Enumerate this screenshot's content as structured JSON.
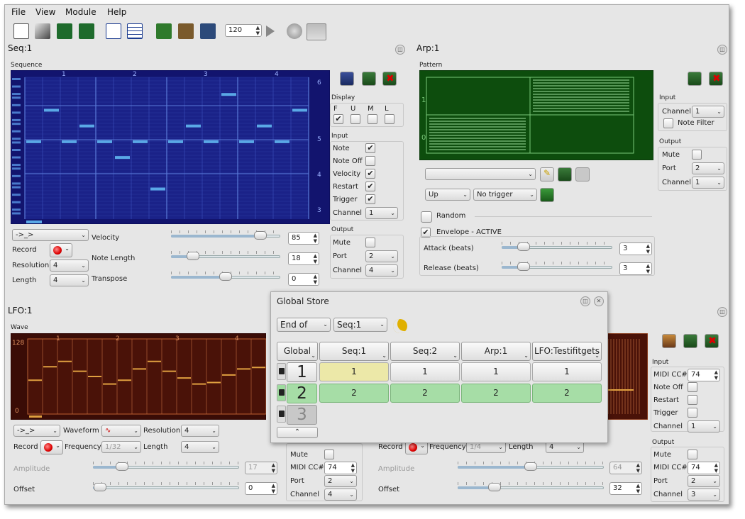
{
  "menu": [
    "File",
    "View",
    "Module",
    "Help"
  ],
  "toolbar": {
    "tempo": "120",
    "icons": [
      "new-file-icon",
      "open-icon",
      "save-icon",
      "save-as-icon",
      "view-icon",
      "list-icon",
      "add-arp-icon",
      "add-lfo-icon",
      "add-seq-icon",
      "play-icon",
      "midi-clock-icon",
      "jack-transport-icon"
    ]
  },
  "seq": {
    "title": "Seq:1",
    "group": "Sequence",
    "bar_labels": [
      "1",
      "2",
      "3",
      "4"
    ],
    "octave_labels": [
      "6",
      "5",
      "4",
      "3"
    ],
    "notes": [
      5,
      6,
      5,
      5.5,
      5,
      4.5,
      5,
      3.5,
      5,
      5.5,
      5,
      6.5,
      5,
      5.5,
      5,
      6
    ],
    "display": {
      "title": "Display",
      "cols": [
        "F",
        "U",
        "M",
        "L"
      ],
      "checked": [
        true,
        false,
        false,
        false
      ]
    },
    "input": {
      "title": "Input",
      "rows": [
        {
          "label": "Note",
          "on": true
        },
        {
          "label": "Note Off",
          "on": false
        },
        {
          "label": "Velocity",
          "on": true
        },
        {
          "label": "Restart",
          "on": true
        },
        {
          "label": "Trigger",
          "on": true
        }
      ],
      "channel_label": "Channel",
      "channel": "1"
    },
    "output": {
      "title": "Output",
      "mute_label": "Mute",
      "port_label": "Port",
      "port": "2",
      "channel_label": "Channel",
      "channel": "4"
    },
    "loop_mode": "->_>",
    "record_label": "Record",
    "resolution_label": "Resolution",
    "resolution": "4",
    "length_label": "Length",
    "length": "4",
    "velocity_label": "Velocity",
    "velocity": "85",
    "velocity_frac": 0.82,
    "note_length_label": "Note Length",
    "note_length": "18",
    "note_length_frac": 0.2,
    "transpose_label": "Transpose",
    "transpose": "0",
    "transpose_frac": 0.5
  },
  "arp": {
    "title": "Arp:1",
    "group": "Pattern",
    "y_labels": [
      "1",
      "0"
    ],
    "pattern_value": "",
    "repeat_mode": "Up",
    "trigger_mode": "No trigger",
    "input": {
      "title": "Input",
      "channel_label": "Channel",
      "channel": "1",
      "note_filter_label": "Note Filter"
    },
    "output": {
      "title": "Output",
      "mute_label": "Mute",
      "port_label": "Port",
      "port": "2",
      "channel_label": "Channel",
      "channel": "1"
    },
    "random_label": "Random",
    "envelope_label": "Envelope - ACTIVE",
    "attack_label": "Attack (beats)",
    "attack": "3",
    "attack_frac": 0.2,
    "release_label": "Release (beats)",
    "release": "3",
    "release_frac": 0.2
  },
  "lfo": {
    "title": "LFO:1",
    "group": "Wave",
    "y_labels": [
      "128",
      "0"
    ],
    "bar_labels": [
      "1",
      "2",
      "3",
      "4"
    ],
    "loop_mode": "->_>",
    "waveform_label": "Waveform",
    "resolution_label": "Resolution",
    "resolution": "4",
    "record_label": "Record",
    "frequency_label": "Frequency",
    "frequency": "1/32",
    "length_label": "Length",
    "length": "4",
    "amplitude_label": "Amplitude",
    "amplitude": "17",
    "amplitude_frac": 0.2,
    "offset_label": "Offset",
    "offset": "0",
    "offset_frac": 0.05,
    "input": {
      "title": "Input",
      "cc_label": "MIDI CC#",
      "cc": "74",
      "note_off_label": "Note Off",
      "restart_label": "Restart",
      "trigger_label": "Trigger",
      "channel_label": "Channel",
      "channel": "1"
    },
    "output": {
      "title": "Output",
      "mute_label": "Mute",
      "cc_label": "MIDI CC#",
      "cc": "74",
      "port_label": "Port",
      "port": "2",
      "channel_label": "Channel",
      "channel": "3"
    },
    "mid_output": {
      "mute_label": "Mute",
      "cc_label": "MIDI CC#",
      "cc": "74",
      "port_label": "Port",
      "port": "2",
      "channel_label": "Channel",
      "channel": "4"
    }
  },
  "lfo2": {
    "record_label": "Record",
    "frequency_label": "Frequency",
    "frequency": "1/4",
    "length_label": "Length",
    "length": "4",
    "amplitude_label": "Amplitude",
    "amplitude": "64",
    "amplitude_frac": 0.5,
    "offset_label": "Offset",
    "offset": "32",
    "offset_frac": 0.25
  },
  "global_store": {
    "title": "Global Store",
    "when": "End of",
    "module": "Seq:1",
    "headers": [
      "Global",
      "Seq:1",
      "Seq:2",
      "Arp:1",
      "LFO:Testifitgets"
    ],
    "rows": [
      {
        "num": "1",
        "cells": [
          "1",
          "1",
          "1",
          "1"
        ]
      },
      {
        "num": "2",
        "cells": [
          "2",
          "2",
          "2",
          "2"
        ]
      },
      {
        "num": "3",
        "cells": []
      }
    ]
  }
}
